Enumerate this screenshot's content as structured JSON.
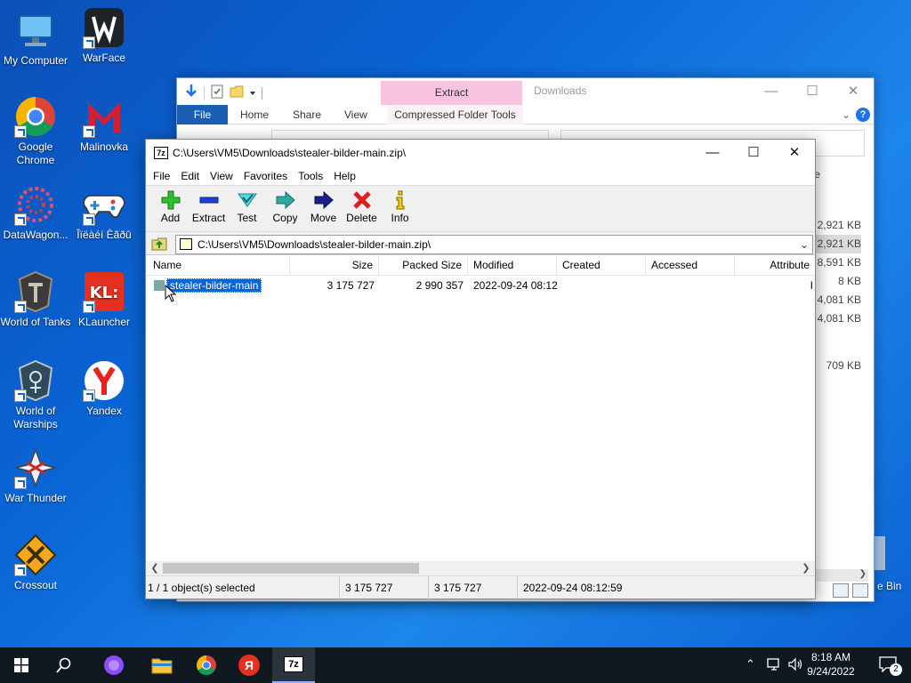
{
  "desktop": {
    "icons": [
      {
        "label": "My Computer",
        "icon": "computer-icon"
      },
      {
        "label": "WarFace",
        "icon": "warface-icon"
      },
      {
        "label": "Google Chrome",
        "icon": "chrome-icon"
      },
      {
        "label": "Malinovka",
        "icon": "malinovka-icon"
      },
      {
        "label": "DataWagon...",
        "icon": "datawagon-icon"
      },
      {
        "label": "Îïëàéí Èãðû",
        "icon": "gamepad-icon"
      },
      {
        "label": "World of Tanks",
        "icon": "world-of-tanks-icon"
      },
      {
        "label": "KLauncher",
        "icon": "klauncher-icon"
      },
      {
        "label": "World of Warships",
        "icon": "world-of-warships-icon"
      },
      {
        "label": "Yandex",
        "icon": "yandex-icon"
      },
      {
        "label": "War Thunder",
        "icon": "war-thunder-icon"
      },
      {
        "label": "Crossout",
        "icon": "crossout-icon"
      }
    ],
    "recycle_bin_partial": "e Bin"
  },
  "explorer": {
    "title": "Downloads",
    "extract_tab": "Extract",
    "tabs": [
      "File",
      "Home",
      "Share",
      "View"
    ],
    "contextual_tab": "Compressed Folder Tools",
    "partial_letter": "e",
    "sizes": [
      "2,921 KB",
      "2,921 KB",
      "8,591 KB",
      "8 KB",
      "4,081 KB",
      "4,081 KB",
      "",
      "709 KB"
    ],
    "selected_size_index": 1
  },
  "zip": {
    "title": "C:\\Users\\VM5\\Downloads\\stealer-bilder-main.zip\\",
    "app_badge": "7z",
    "menu": [
      "File",
      "Edit",
      "View",
      "Favorites",
      "Tools",
      "Help"
    ],
    "toolbar": [
      {
        "label": "Add",
        "icon": "add-icon"
      },
      {
        "label": "Extract",
        "icon": "extract-icon"
      },
      {
        "label": "Test",
        "icon": "test-icon"
      },
      {
        "label": "Copy",
        "icon": "copy-icon"
      },
      {
        "label": "Move",
        "icon": "move-icon"
      },
      {
        "label": "Delete",
        "icon": "delete-icon"
      },
      {
        "label": "Info",
        "icon": "info-icon"
      }
    ],
    "address": "C:\\Users\\VM5\\Downloads\\stealer-bilder-main.zip\\",
    "columns": [
      "Name",
      "Size",
      "Packed Size",
      "Modified",
      "Created",
      "Accessed",
      "Attribute"
    ],
    "rows": [
      {
        "name": "stealer-bilder-main",
        "size": "3 175 727",
        "packed": "2 990 357",
        "modified": "2022-09-24 08:12",
        "created": "",
        "accessed": "",
        "attr": "I"
      }
    ],
    "status": {
      "selection": "1 / 1 object(s) selected",
      "size": "3 175 727",
      "packed": "3 175 727",
      "modified": "2022-09-24 08:12:59"
    }
  },
  "taskbar": {
    "time": "8:18 AM",
    "date": "9/24/2022",
    "notification_count": "2",
    "pinned": [
      "alice-icon",
      "file-explorer-icon",
      "chrome-icon",
      "yandex-browser-icon",
      "7zip-icon"
    ],
    "seven_zip_label": "7z",
    "yandex_letter": "Я"
  },
  "colors": {
    "accent": "#0a64d8",
    "ribbon_file": "#1a5fb4",
    "extract_tab": "#f7c3df"
  }
}
